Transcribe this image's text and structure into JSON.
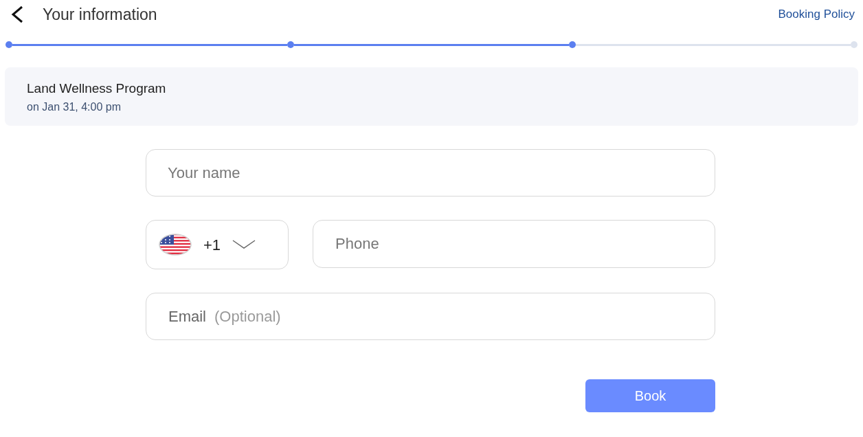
{
  "header": {
    "title": "Your information",
    "policy_link": "Booking Policy"
  },
  "progress": {
    "steps": [
      {
        "done": true
      },
      {
        "done": true
      },
      {
        "done": true
      },
      {
        "done": false
      }
    ]
  },
  "booking": {
    "title": "Land Wellness Program",
    "when": "on Jan 31, 4:00 pm"
  },
  "form": {
    "name": {
      "placeholder": "Your name"
    },
    "country": {
      "code": "+1"
    },
    "phone": {
      "placeholder": "Phone"
    },
    "email": {
      "placeholder": "Email",
      "hint": "(Optional)"
    }
  },
  "book_button": "Book"
}
